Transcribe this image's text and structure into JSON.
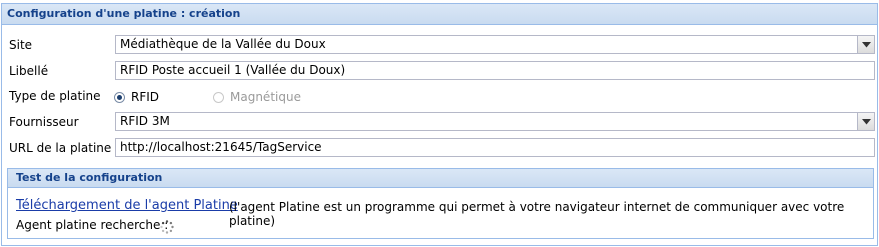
{
  "panel": {
    "title": "Configuration d'une platine : création"
  },
  "form": {
    "site": {
      "label": "Site",
      "value": "Médiathèque de la Vallée du Doux"
    },
    "libelle": {
      "label": "Libellé",
      "value": "RFID Poste accueil 1 (Vallée du Doux)"
    },
    "type_platine": {
      "label": "Type de platine",
      "options": [
        {
          "label": "RFID",
          "selected": true,
          "disabled": false
        },
        {
          "label": "Magnétique",
          "selected": false,
          "disabled": true
        }
      ]
    },
    "fournisseur": {
      "label": "Fournisseur",
      "value": "RFID 3M"
    },
    "url": {
      "label": "URL de la platine",
      "value": "http://localhost:21645/TagService"
    }
  },
  "test": {
    "title": "Test de la configuration",
    "download_link": "Téléchargement de l'agent Platine",
    "download_desc": "(l'agent Platine est un programme qui permet à votre navigateur internet de communiquer avec votre platine)",
    "agent_status": "Agent platine recherche :"
  },
  "icons": {
    "combo_trigger": "chevron-down-icon",
    "loading": "loading-spinner-icon"
  },
  "colors": {
    "header_text": "#15428b",
    "border": "#99bbe8",
    "link": "#1a3ca8"
  }
}
